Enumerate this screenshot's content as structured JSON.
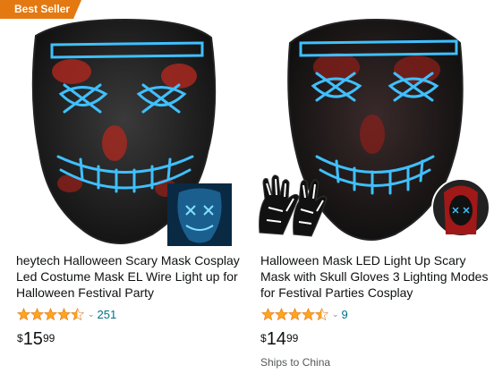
{
  "products": [
    {
      "badge": "Best Seller",
      "title": "heytech Halloween Scary Mask Cosplay Led Costume Mask EL Wire Light up for Halloween Festival Party",
      "rating": 4.5,
      "review_count": "251",
      "price": {
        "currency": "$",
        "whole": "15",
        "fraction": "99"
      }
    },
    {
      "title": "Halloween Mask LED Light Up Scary Mask with Skull Gloves 3 Lighting Modes for Festival Parties Cosplay",
      "rating": 4.5,
      "review_count": "9",
      "price": {
        "currency": "$",
        "whole": "14",
        "fraction": "99"
      },
      "shipping": "Ships to China"
    }
  ],
  "colors": {
    "badge": "#e47911",
    "star": "#ffa41c",
    "link": "#007185",
    "neon": "#3fc0ff"
  },
  "icons": {
    "star": "star-icon",
    "half_star": "star-half-icon",
    "chevron": "chevron-down-icon"
  }
}
